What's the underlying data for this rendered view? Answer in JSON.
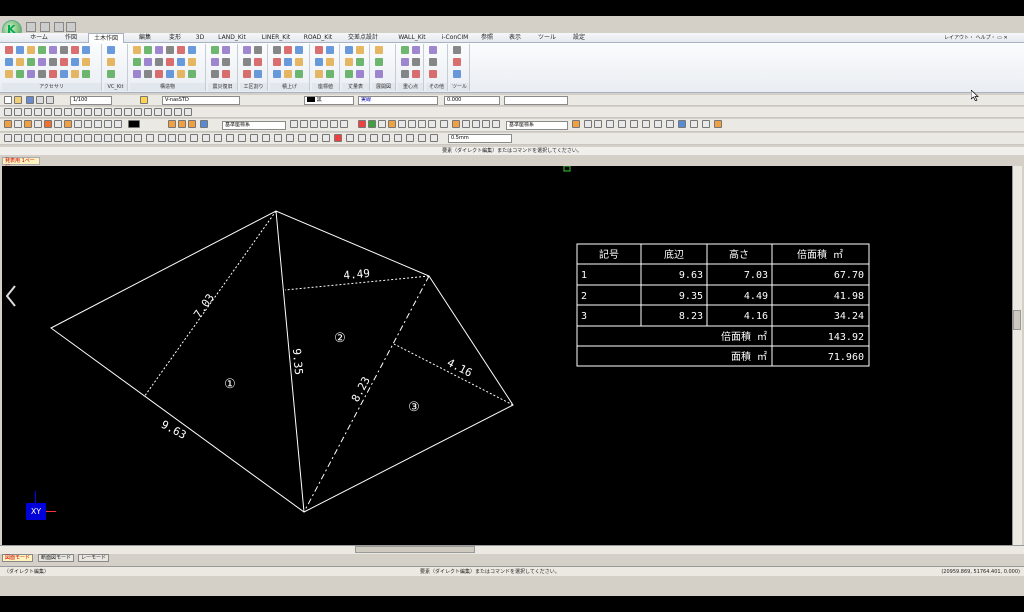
{
  "app": {
    "logo_letter": "K",
    "right_menu": "レイアウト・ ヘルプ・ ▭ ✕"
  },
  "ribbon": {
    "tabs": [
      "ホーム",
      "作図",
      "土木作図",
      "編集",
      "変形",
      "3D",
      "LAND_Kit",
      "LINER_Kit",
      "ROAD_Kit",
      "交差点設計",
      "WALL_Kit",
      "i-ConCIM",
      "参照",
      "表示",
      "ツール",
      "設定"
    ],
    "active_tab": "土木作図",
    "groups": [
      "アクセサリ",
      "VC_Kit",
      "構造物",
      "震災復旧",
      "工区割り",
      "積上げ",
      "座標値",
      "丈量表",
      "展開図",
      "重心点",
      "その他",
      "ツール"
    ]
  },
  "toolbar": {
    "scale": "1/100",
    "font": "V-nasSTD",
    "color_label": "黒",
    "layer": "実線",
    "line_width": "0.000",
    "coord_system_1": "基準座標系",
    "coord_system_2": "基準座標系",
    "pen_width": "0.5mm"
  },
  "prompt": "要素（ダイレクト編集）またはコマンドを選択してください。",
  "document": {
    "tab_label": "発表用 1ページ"
  },
  "drawing": {
    "line_color": "#ffffff",
    "triangles": [
      {
        "mark": "①",
        "base": "9.63",
        "height": "7.03"
      },
      {
        "mark": "②",
        "base": "9.35",
        "height": "4.49"
      },
      {
        "mark": "③",
        "base": "8.23",
        "height": "4.16"
      }
    ]
  },
  "area_table": {
    "headers": [
      "記号",
      "底辺",
      "高さ",
      "倍面積 ㎡"
    ],
    "rows": [
      [
        "1",
        "9.63",
        "7.03",
        "67.70"
      ],
      [
        "2",
        "9.35",
        "4.49",
        "41.98"
      ],
      [
        "3",
        "8.23",
        "4.16",
        "34.24"
      ]
    ],
    "double_area_label": "倍面積 ㎡",
    "double_area_value": "143.92",
    "area_label": "面積 ㎡",
    "area_value": "71.960"
  },
  "axis_badge": "XY",
  "mode_tabs": [
    "図面モード",
    "断面図モード",
    "レーモード"
  ],
  "active_mode": "図面モード",
  "status": {
    "left": "（ダイレクト編集）",
    "center": "要素（ダイレクト編集）またはコマンドを選択してください。",
    "coords": "(20959.869, 51764.401, 0.000)"
  }
}
